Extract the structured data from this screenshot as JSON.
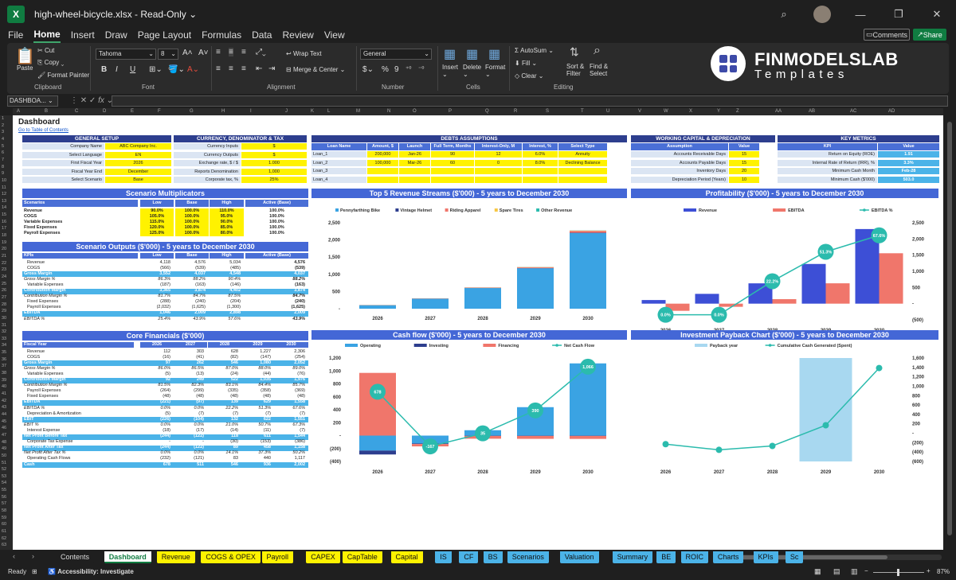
{
  "titlebar": {
    "file_name": "high-wheel-bicycle.xlsx",
    "mode": "Read-Only",
    "mode_caret": "⌄"
  },
  "menu": [
    "File",
    "Home",
    "Insert",
    "Draw",
    "Page Layout",
    "Formulas",
    "Data",
    "Review",
    "View"
  ],
  "header_buttons": {
    "comments": "Comments",
    "share": "Share"
  },
  "ribbon": {
    "paste": "Paste",
    "cut": "Cut",
    "copy": "Copy",
    "format_painter": "Format Painter",
    "clipboard": "Clipboard",
    "font_name": "Tahoma",
    "font_size": "8",
    "font_group": "Font",
    "wrap_text": "Wrap Text",
    "merge_center": "Merge & Center",
    "alignment": "Alignment",
    "number_format": "General",
    "number": "Number",
    "insert": "Insert",
    "delete": "Delete",
    "format": "Format",
    "cells": "Cells",
    "autosum": "AutoSum",
    "fill": "Fill",
    "clear": "Clear",
    "sort_filter": "Sort & Filter",
    "find_select": "Find & Select",
    "editing": "Editing",
    "bold": "B",
    "italic": "I",
    "underline": "U",
    "currency": "$",
    "percent": "%",
    "comma": "9"
  },
  "logo": {
    "line1": "FINMODELSLAB",
    "line2": "Templates"
  },
  "formula_bar": {
    "name_box": "DASHBOA...",
    "fx": "fx"
  },
  "columns": [
    "A",
    "B",
    "C",
    "D",
    "E",
    "F",
    "G",
    "H",
    "I",
    "J",
    "K",
    "L",
    "M",
    "N",
    "O",
    "P",
    "Q",
    "R",
    "S",
    "T",
    "U",
    "V",
    "W",
    "X",
    "Y",
    "Z",
    "AA",
    "AB",
    "AC",
    "AD"
  ],
  "sheet": {
    "title": "Dashboard",
    "link": "Go to Table of Contents",
    "general_setup": {
      "title": "GENERAL SETUP",
      "rows": [
        [
          "Company Name",
          "ABC Company Inc."
        ],
        [
          "Select Language",
          "EN"
        ],
        [
          "First Fiscal Year",
          "2026"
        ],
        [
          "Fiscal Year End",
          "December"
        ],
        [
          "Select Scenario",
          "Base"
        ]
      ]
    },
    "currency": {
      "title": "CURRENCY, DENOMINATOR & TAX",
      "rows": [
        [
          "Currency Inputs",
          "$"
        ],
        [
          "Currency Outputs",
          "$"
        ],
        [
          "Exchange rate, $ / $",
          "1.000"
        ],
        [
          "Reports Denomination",
          "1,000"
        ],
        [
          "Corporate tax, %",
          "25%"
        ]
      ]
    },
    "debts": {
      "title": "DEBTS ASSUMPTIONS",
      "headers": [
        "Loan Name",
        "Amount, $",
        "Launch",
        "Full Term, Months",
        "Interest-Only, M",
        "Interest, %",
        "Select Type"
      ],
      "rows": [
        [
          "Loan_1",
          "200,000",
          "Jan-26",
          "90",
          "12",
          "6.0%",
          "Annuity"
        ],
        [
          "Loan_2",
          "100,000",
          "Mar-26",
          "60",
          "0",
          "8.0%",
          "Declining Balance"
        ],
        [
          "Loan_3",
          "",
          "",
          "",
          "",
          "",
          ""
        ],
        [
          "Loan_4",
          "",
          "",
          "",
          "",
          "",
          ""
        ]
      ]
    },
    "working_capital": {
      "title": "WORKING CAPITAL & DEPRECIATION",
      "headers": [
        "Assumption",
        "Value"
      ],
      "rows": [
        [
          "Accounts Receivable Days",
          "15"
        ],
        [
          "Accounts Payable Days",
          "15"
        ],
        [
          "Inventory Days",
          "20"
        ],
        [
          "Depreciation Period (Years)",
          "10"
        ]
      ]
    },
    "key_metrics": {
      "title": "KEY METRICS",
      "headers": [
        "KPI",
        "Value"
      ],
      "rows": [
        [
          "Return on Equity (ROE)",
          "1.91"
        ],
        [
          "Internal Rate of Return (IRR), %",
          "3.3%"
        ],
        [
          "Minimum Cash Month",
          "Feb-28"
        ],
        [
          "Minimum Cash ($'000)",
          "503.0"
        ]
      ]
    },
    "scenario_mult": {
      "title": "Scenario Multiplicators",
      "headers": [
        "Scenarios",
        "Low",
        "Base",
        "High",
        "Active (Base)"
      ],
      "rows": [
        [
          "Revenue",
          "90.0%",
          "100.0%",
          "110.0%",
          "100.0%"
        ],
        [
          "COGS",
          "105.0%",
          "100.0%",
          "95.0%",
          "100.0%"
        ],
        [
          "Variable Expenses",
          "115.0%",
          "100.0%",
          "90.0%",
          "100.0%"
        ],
        [
          "Fixed Expenses",
          "120.0%",
          "100.0%",
          "85.0%",
          "100.0%"
        ],
        [
          "Payroll Expenses",
          "125.0%",
          "100.0%",
          "80.0%",
          "100.0%"
        ]
      ]
    },
    "scenario_out": {
      "title": "Scenario Outputs ($'000) - 5 years to December 2030",
      "headers": [
        "KPIs",
        "Low",
        "Base",
        "High",
        "Active (Base)"
      ],
      "rows": [
        {
          "l": "Revenue",
          "v": [
            "4,118",
            "4,576",
            "5,034",
            "4,576"
          ],
          "s": ""
        },
        {
          "l": "COGS",
          "v": [
            "(566)",
            "(539)",
            "(485)",
            "(539)"
          ],
          "s": ""
        },
        {
          "l": "Gross Margin",
          "v": [
            "3,552",
            "4,037",
            "4,548",
            "4,037"
          ],
          "s": "band"
        },
        {
          "l": "Gross Margin %",
          "v": [
            "86.3%",
            "88.2%",
            "90.4%",
            "88.2%"
          ],
          "s": "it"
        },
        {
          "l": "Variable Expenses",
          "v": [
            "(187)",
            "(163)",
            "(146)",
            "(163)"
          ],
          "s": ""
        },
        {
          "l": "Contribution Margin",
          "v": [
            "3,365",
            "3,874",
            "4,402",
            "3,874"
          ],
          "s": "band"
        },
        {
          "l": "Contribution Margin %",
          "v": [
            "81.7%",
            "84.7%",
            "87.5%",
            "84.7%"
          ],
          "s": "it"
        },
        {
          "l": "Fixed Expenses",
          "v": [
            "(288)",
            "(240)",
            "(204)",
            "(240)"
          ],
          "s": ""
        },
        {
          "l": "Payroll Expenses",
          "v": [
            "(2,032)",
            "(1,625)",
            "(1,300)",
            "(1,625)"
          ],
          "s": ""
        },
        {
          "l": "EBITDA",
          "v": [
            "1,046",
            "2,009",
            "2,898",
            "2,009"
          ],
          "s": "band"
        },
        {
          "l": "EBITDA %",
          "v": [
            "25.4%",
            "43.9%",
            "57.6%",
            "43.9%"
          ],
          "s": "it"
        }
      ]
    },
    "core": {
      "title": "Core Financials ($'000)",
      "headers": [
        "Fiscal Year",
        "2026",
        "2027",
        "2028",
        "2029",
        "2030"
      ],
      "rows": [
        {
          "l": "Revenue",
          "v": [
            "112",
            "303",
            "628",
            "1,227",
            "2,306"
          ],
          "s": ""
        },
        {
          "l": "COGS",
          "v": [
            "(16)",
            "(41)",
            "(82)",
            "(147)",
            "(254)"
          ],
          "s": ""
        },
        {
          "l": "Gross Margin",
          "v": [
            "97",
            "262",
            "546",
            "1,080",
            "2,052"
          ],
          "s": "band"
        },
        {
          "l": "Gross Margin %",
          "v": [
            "86.0%",
            "86.5%",
            "87.0%",
            "88.0%",
            "89.0%"
          ],
          "s": "it"
        },
        {
          "l": "Variable Expenses",
          "v": [
            "(5)",
            "(13)",
            "(24)",
            "(44)",
            "(76)"
          ],
          "s": ""
        },
        {
          "l": "Contribution Margin",
          "v": [
            "92",
            "249",
            "522",
            "1,035",
            "1,976"
          ],
          "s": "band"
        },
        {
          "l": "Contribution Margin %",
          "v": [
            "81.5%",
            "82.3%",
            "83.1%",
            "84.4%",
            "85.7%"
          ],
          "s": "it"
        },
        {
          "l": "Payroll Expenses",
          "v": [
            "(264)",
            "(299)",
            "(335)",
            "(358)",
            "(369)"
          ],
          "s": ""
        },
        {
          "l": "Fixed Expenses",
          "v": [
            "(48)",
            "(48)",
            "(48)",
            "(48)",
            "(48)"
          ],
          "s": ""
        },
        {
          "l": "EBITDA",
          "v": [
            "(221)",
            "(97)",
            "139",
            "629",
            "1,558"
          ],
          "s": "band"
        },
        {
          "l": "EBITDA %",
          "v": [
            "0.0%",
            "0.0%",
            "22.2%",
            "51.3%",
            "67.6%"
          ],
          "s": "it"
        },
        {
          "l": "Depreciation & Amortization",
          "v": [
            "(5)",
            "(7)",
            "(7)",
            "(7)",
            "(7)"
          ],
          "s": ""
        },
        {
          "l": "EBIT",
          "v": [
            "(226)",
            "(104)",
            "132",
            "622",
            "1,551"
          ],
          "s": "band"
        },
        {
          "l": "EBIT %",
          "v": [
            "0.0%",
            "0.0%",
            "21.0%",
            "50.7%",
            "67.3%"
          ],
          "s": "it"
        },
        {
          "l": "Interest Expense",
          "v": [
            "(18)",
            "(17)",
            "(14)",
            "(11)",
            "(7)"
          ],
          "s": ""
        },
        {
          "l": "Net Profit Before Tax",
          "v": [
            "(244)",
            "(122)",
            "118",
            "611",
            "1,544"
          ],
          "s": "band"
        },
        {
          "l": "Corporate Tax Expense",
          "v": [
            "-",
            "-",
            "(30)",
            "(153)",
            "(386)"
          ],
          "s": ""
        },
        {
          "l": "Net Profit After Tax",
          "v": [
            "(244)",
            "(122)",
            "89",
            "458",
            "1,158"
          ],
          "s": "band"
        },
        {
          "l": "Net Profit After Tax %",
          "v": [
            "0.0%",
            "0.0%",
            "14.1%",
            "37.3%",
            "50.2%"
          ],
          "s": "it"
        },
        {
          "l": "Operating Cash Flows",
          "v": [
            "(232)",
            "(121)",
            "83",
            "440",
            "1,117"
          ],
          "s": ""
        },
        {
          "l": "Cash",
          "v": [
            "678",
            "511",
            "546",
            "936",
            "2,002"
          ],
          "s": "band"
        }
      ]
    }
  },
  "chart_data": [
    {
      "type": "bar",
      "title": "Top 5 Revenue Streams ($'000) - 5 years to December 2030",
      "categories": [
        "2026",
        "2027",
        "2028",
        "2029",
        "2030"
      ],
      "series": [
        {
          "name": "Pennyfarthing Bike",
          "color": "#3aa3e3",
          "values": [
            100,
            290,
            600,
            1175,
            2200
          ]
        },
        {
          "name": "Vintage Helmet",
          "color": "#2d3e8e",
          "values": [
            2,
            3,
            5,
            8,
            10
          ]
        },
        {
          "name": "Riding Apparel",
          "color": "#f0766b",
          "values": [
            5,
            7,
            12,
            25,
            55
          ]
        },
        {
          "name": "Spare Tires",
          "color": "#f7c744",
          "values": [
            2,
            2,
            3,
            5,
            8
          ]
        },
        {
          "name": "Other Revenue",
          "color": "#2bbbad",
          "values": [
            1,
            1,
            2,
            3,
            4
          ]
        }
      ],
      "yticks": [
        "-",
        "500",
        "1,000",
        "1,500",
        "2,000",
        "2,500"
      ],
      "ylim": [
        0,
        2500
      ]
    },
    {
      "type": "bar",
      "title": "Profitability ($'000) - 5 years to December 2030",
      "categories": [
        "2026",
        "2027",
        "2028",
        "2029",
        "2030"
      ],
      "series": [
        {
          "name": "Revenue",
          "color": "#3d4fd6",
          "values": [
            112,
            303,
            628,
            1227,
            2306
          ]
        },
        {
          "name": "EBITDA",
          "color": "#f0766b",
          "values": [
            -221,
            -97,
            139,
            629,
            1558
          ]
        },
        {
          "name": "EBITDA %",
          "color": "#2bbbad",
          "values": [
            0,
            0,
            22.2,
            51.3,
            67.6
          ],
          "labels": [
            "0.0%",
            "0.0%",
            "22.2%",
            "51.3%",
            "67.6%"
          ]
        }
      ],
      "yticks": [
        "(500)",
        "-",
        "500",
        "1,000",
        "1,500",
        "2,000",
        "2,500"
      ],
      "ylim": [
        -500,
        2500
      ],
      "y2lim": [
        0,
        80
      ]
    },
    {
      "type": "bar",
      "title": "Cash flow ($'000) - 5 years to December 2030",
      "categories": [
        "2026",
        "2027",
        "2028",
        "2029",
        "2030"
      ],
      "series": [
        {
          "name": "Operating",
          "color": "#3aa3e3",
          "values": [
            -232,
            -121,
            83,
            440,
            1117
          ]
        },
        {
          "name": "Investing",
          "color": "#2d3e8e",
          "values": [
            -60,
            -10,
            -5,
            -5,
            -5
          ]
        },
        {
          "name": "Financing",
          "color": "#f0766b",
          "values": [
            970,
            -36,
            -43,
            -45,
            -46
          ]
        },
        {
          "name": "Net Cash Flow",
          "color": "#2bbbad",
          "values": [
            678,
            -167,
            35,
            390,
            1066
          ],
          "labels": [
            "678",
            "-167",
            "35",
            "390",
            "1,066"
          ]
        }
      ],
      "yticks": [
        "(400)",
        "(200)",
        "-",
        "200",
        "400",
        "600",
        "800",
        "1,000",
        "1,200"
      ],
      "ylim": [
        -400,
        1200
      ]
    },
    {
      "type": "bar",
      "title": "Investment Payback Chart ($'000) - 5 years to December 2030",
      "categories": [
        "2026",
        "2027",
        "2028",
        "2029",
        "2030"
      ],
      "series": [
        {
          "name": "Payback year",
          "color": "#a8d8f0",
          "values": [
            0,
            0,
            0,
            1,
            0
          ]
        },
        {
          "name": "Cumulative Cash Generated (Spent)",
          "color": "#2bbbad",
          "values": [
            -232,
            -353,
            -270,
            170,
            1387
          ]
        }
      ],
      "yticks": [
        "(600)",
        "(400)",
        "(200)",
        "-",
        "200",
        "400",
        "600",
        "800",
        "1,000",
        "1,200",
        "1,400",
        "1,600"
      ],
      "ylim": [
        -600,
        1600
      ]
    }
  ],
  "tabs": [
    {
      "label": "Contents",
      "color": "#1f1f1f",
      "text": "#ddd"
    },
    {
      "label": "Dashboard",
      "color": "#ffffff",
      "text": "#107c41"
    },
    {
      "label": "Revenue",
      "color": "#fff200",
      "text": "#111"
    },
    {
      "label": "COGS & OPEX",
      "color": "#fff200",
      "text": "#111"
    },
    {
      "label": "Payroll",
      "color": "#fff200",
      "text": "#111"
    },
    {
      "label": "CAPEX",
      "color": "#fff200",
      "text": "#111"
    },
    {
      "label": "CapTable",
      "color": "#fff200",
      "text": "#111"
    },
    {
      "label": "Capital",
      "color": "#fff200",
      "text": "#111"
    },
    {
      "label": "IS",
      "color": "#4bb3e8",
      "text": "#111"
    },
    {
      "label": "CF",
      "color": "#4bb3e8",
      "text": "#111"
    },
    {
      "label": "BS",
      "color": "#4bb3e8",
      "text": "#111"
    },
    {
      "label": "Scenarios",
      "color": "#4bb3e8",
      "text": "#111"
    },
    {
      "label": "Valuation",
      "color": "#4bb3e8",
      "text": "#111"
    },
    {
      "label": "Summary",
      "color": "#4bb3e8",
      "text": "#111"
    },
    {
      "label": "BE",
      "color": "#4bb3e8",
      "text": "#111"
    },
    {
      "label": "ROIC",
      "color": "#4bb3e8",
      "text": "#111"
    },
    {
      "label": "Charts",
      "color": "#4bb3e8",
      "text": "#111"
    },
    {
      "label": "KPIs",
      "color": "#4bb3e8",
      "text": "#111"
    },
    {
      "label": "Sc",
      "color": "#4bb3e8",
      "text": "#111"
    }
  ],
  "status": {
    "ready": "Ready",
    "accessibility": "Accessibility: Investigate",
    "zoom": "87%"
  }
}
